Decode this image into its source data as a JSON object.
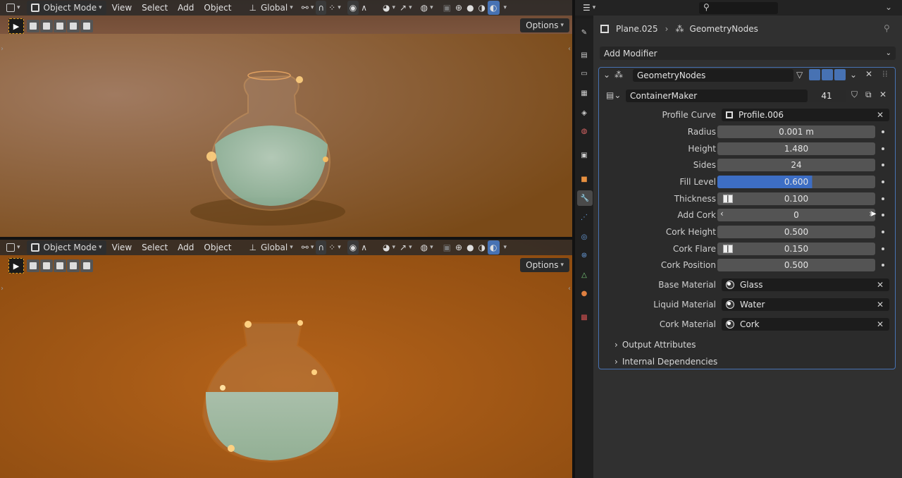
{
  "viewport_header": {
    "mode": "Object Mode",
    "menus": [
      "View",
      "Select",
      "Add",
      "Object"
    ],
    "orientation": "Global",
    "options": "Options"
  },
  "properties": {
    "object_name": "Plane.025",
    "modifier_breadcrumb": "GeometryNodes",
    "add_modifier": "Add Modifier",
    "modifier_name": "GeometryNodes",
    "node_group": "ContainerMaker",
    "node_group_users": "41",
    "params": [
      {
        "label": "Profile Curve",
        "value": "Profile.006",
        "kind": "object"
      },
      {
        "label": "Radius",
        "value": "0.001 m",
        "kind": "num"
      },
      {
        "label": "Height",
        "value": "1.480",
        "kind": "num"
      },
      {
        "label": "Sides",
        "value": "24",
        "kind": "num"
      },
      {
        "label": "Fill Level",
        "value": "0.600",
        "kind": "slider",
        "fraction": 0.6
      },
      {
        "label": "Thickness",
        "value": "0.100",
        "kind": "num-icon"
      },
      {
        "label": "Add Cork",
        "value": "0",
        "kind": "stepper"
      },
      {
        "label": "Cork Height",
        "value": "0.500",
        "kind": "num"
      },
      {
        "label": "Cork Flare",
        "value": "0.150",
        "kind": "num-icon"
      },
      {
        "label": "Cork Position",
        "value": "0.500",
        "kind": "num"
      },
      {
        "label": "Base Material",
        "value": "Glass",
        "kind": "material"
      },
      {
        "label": "Liquid Material",
        "value": "Water",
        "kind": "material"
      },
      {
        "label": "Cork Material",
        "value": "Cork",
        "kind": "material"
      }
    ],
    "sections": [
      "Output Attributes",
      "Internal Dependencies"
    ]
  },
  "colors": {
    "accent": "#4772b3",
    "slider": "#3d6ec4",
    "viewport_floor": "#b5631a"
  }
}
